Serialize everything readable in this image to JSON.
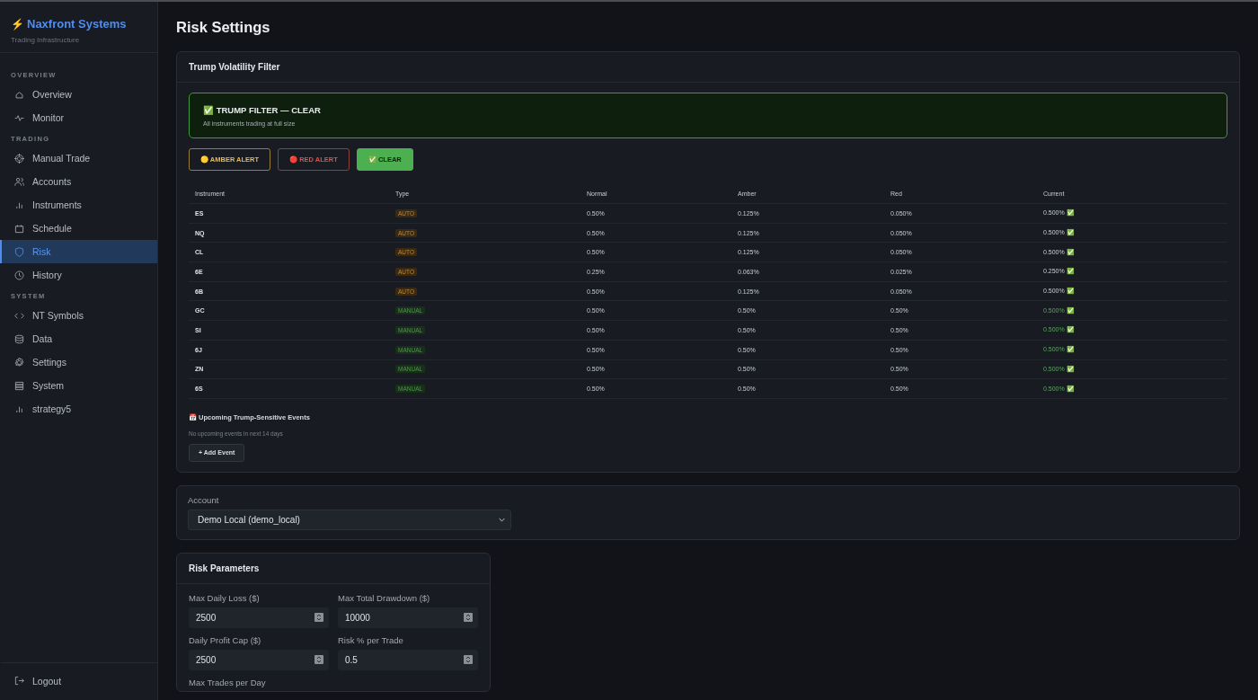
{
  "sidebar": {
    "brand": {
      "bolt": "⚡",
      "name": "Naxfront Systems",
      "tagline": "Trading Infrastructure"
    },
    "sections": [
      {
        "title": "OVERVIEW",
        "items": [
          {
            "label": "Overview",
            "selected": false
          },
          {
            "label": "Monitor",
            "selected": false
          }
        ]
      },
      {
        "title": "TRADING",
        "items": [
          {
            "label": "Manual Trade",
            "selected": false
          },
          {
            "label": "Accounts",
            "selected": false
          },
          {
            "label": "Instruments",
            "selected": false
          },
          {
            "label": "Schedule",
            "selected": false
          },
          {
            "label": "Risk",
            "selected": true
          },
          {
            "label": "History",
            "selected": false
          }
        ]
      },
      {
        "title": "SYSTEM",
        "items": [
          {
            "label": "NT Symbols",
            "selected": false
          },
          {
            "label": "Data",
            "selected": false
          },
          {
            "label": "Settings",
            "selected": false
          },
          {
            "label": "System",
            "selected": false
          },
          {
            "label": "strategy5",
            "selected": false
          }
        ]
      }
    ],
    "logout": "Logout"
  },
  "page_title": "Risk Settings",
  "filter_card": {
    "title": "Trump Volatility Filter",
    "status": {
      "heading": "✅ TRUMP FILTER — CLEAR",
      "detail": "All instruments trading at full size"
    },
    "alert_buttons": [
      {
        "kind": "amber",
        "label": "🟡 AMBER ALERT",
        "selected": false
      },
      {
        "kind": "red",
        "label": "🔴 RED ALERT",
        "selected": false
      },
      {
        "kind": "clear",
        "label": "✅ CLEAR",
        "selected": true
      }
    ],
    "table": {
      "columns": [
        "Instrument",
        "Type",
        "Normal",
        "Amber",
        "Red",
        "Current"
      ],
      "rows": [
        {
          "instrument": "ES",
          "type": "AUTO",
          "kind": "auto",
          "normal": "0.50%",
          "amber": "0.125%",
          "red": "0.050%",
          "current": "0.500% ✅"
        },
        {
          "instrument": "NQ",
          "type": "AUTO",
          "kind": "auto",
          "normal": "0.50%",
          "amber": "0.125%",
          "red": "0.050%",
          "current": "0.500% ✅"
        },
        {
          "instrument": "CL",
          "type": "AUTO",
          "kind": "auto",
          "normal": "0.50%",
          "amber": "0.125%",
          "red": "0.050%",
          "current": "0.500% ✅"
        },
        {
          "instrument": "6E",
          "type": "AUTO",
          "kind": "auto",
          "normal": "0.25%",
          "amber": "0.063%",
          "red": "0.025%",
          "current": "0.250% ✅"
        },
        {
          "instrument": "6B",
          "type": "AUTO",
          "kind": "auto",
          "normal": "0.50%",
          "amber": "0.125%",
          "red": "0.050%",
          "current": "0.500% ✅"
        },
        {
          "instrument": "GC",
          "type": "MANUAL",
          "kind": "manual",
          "normal": "0.50%",
          "amber": "0.50%",
          "red": "0.50%",
          "current": "0.500% ✅"
        },
        {
          "instrument": "SI",
          "type": "MANUAL",
          "kind": "manual",
          "normal": "0.50%",
          "amber": "0.50%",
          "red": "0.50%",
          "current": "0.500% ✅"
        },
        {
          "instrument": "6J",
          "type": "MANUAL",
          "kind": "manual",
          "normal": "0.50%",
          "amber": "0.50%",
          "red": "0.50%",
          "current": "0.500% ✅"
        },
        {
          "instrument": "ZN",
          "type": "MANUAL",
          "kind": "manual",
          "normal": "0.50%",
          "amber": "0.50%",
          "red": "0.50%",
          "current": "0.500% ✅"
        },
        {
          "instrument": "6S",
          "type": "MANUAL",
          "kind": "manual",
          "normal": "0.50%",
          "amber": "0.50%",
          "red": "0.50%",
          "current": "0.500% ✅"
        }
      ]
    },
    "events": {
      "title": "📅 Upcoming Trump-Sensitive Events",
      "empty": "No upcoming events in next 14 days",
      "add_button": "+ Add Event"
    }
  },
  "account": {
    "label": "Account",
    "value": "Demo Local (demo_local)"
  },
  "risk_parameters": {
    "title": "Risk Parameters",
    "fields": [
      {
        "label": "Max Daily Loss ($)",
        "value": "2500"
      },
      {
        "label": "Max Total Drawdown ($)",
        "value": "10000"
      },
      {
        "label": "Daily Profit Cap ($)",
        "value": "2500"
      },
      {
        "label": "Risk % per Trade",
        "value": "0.5"
      }
    ],
    "next_label": "Max Trades per Day"
  }
}
